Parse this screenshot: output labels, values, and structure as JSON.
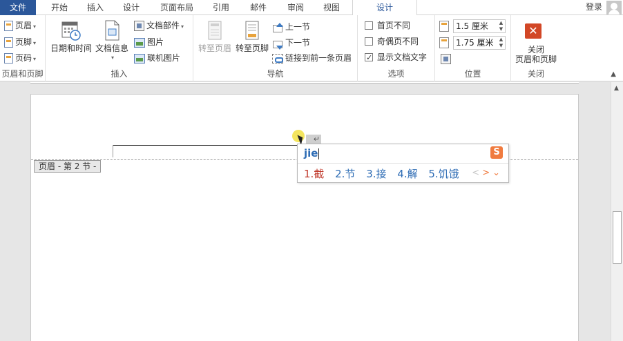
{
  "tabs": {
    "file": "文件",
    "items": [
      "开始",
      "插入",
      "设计",
      "页面布局",
      "引用",
      "邮件",
      "审阅",
      "视图"
    ],
    "active": "设计"
  },
  "account": {
    "login": "登录"
  },
  "ribbon": {
    "header_footer": {
      "header": "页眉",
      "footer": "页脚",
      "page_number": "页码",
      "label": "页眉和页脚"
    },
    "insert": {
      "date_time": "日期和时间",
      "doc_info": "文档信息",
      "doc_parts": "文档部件",
      "picture": "图片",
      "online_picture": "联机图片",
      "label": "插入"
    },
    "navigation": {
      "goto_header": "转至页眉",
      "goto_footer": "转至页脚",
      "previous": "上一节",
      "next": "下一节",
      "link_previous": "链接到前一条页眉",
      "label": "导航"
    },
    "options": {
      "different_first": "首页不同",
      "different_odd_even": "奇偶页不同",
      "show_doc_text": "显示文档文字",
      "show_doc_text_checked": true,
      "label": "选项"
    },
    "position": {
      "header_from_top": "1.5 厘米",
      "footer_from_bottom": "1.75 厘米",
      "label": "位置"
    },
    "close": {
      "line1": "关闭",
      "line2": "页眉和页脚",
      "label": "关闭"
    }
  },
  "document": {
    "header_tag": "页眉 - 第 2 节 -",
    "paragraph_mark": "↵"
  },
  "ime": {
    "composition": "jie",
    "candidates": [
      "1.截",
      "2.节",
      "3.接",
      "4.解",
      "5.饥饿"
    ],
    "logo": "S",
    "nav": {
      "prev": "<",
      "next": ">",
      "expand": "⌄"
    }
  },
  "colors": {
    "file_tab": "#2b579a",
    "active_tab_text": "#2b579a",
    "close_button": "#d24726",
    "ime_logo": "#f07b3f",
    "ime_candidate": "#2f6db5",
    "ime_first_candidate": "#c0392b"
  }
}
